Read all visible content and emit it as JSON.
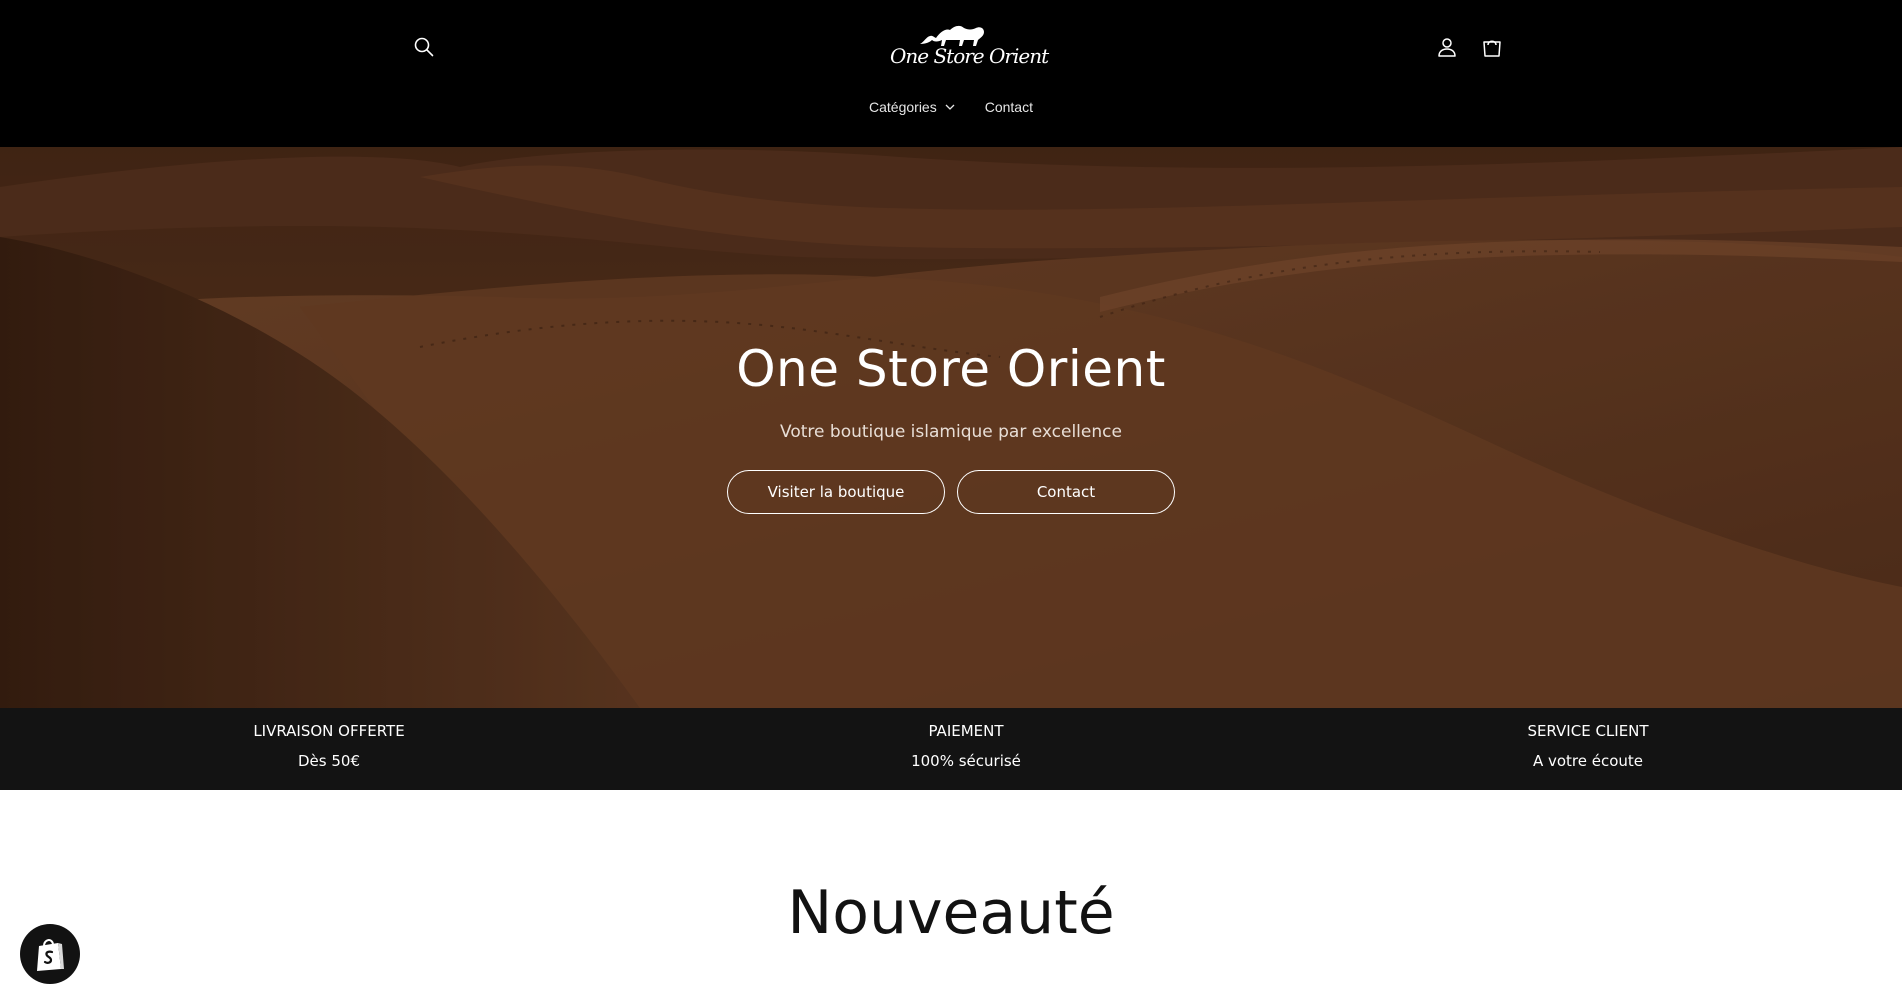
{
  "header": {
    "logo_text": "One Store Orient",
    "icons": {
      "search": "search-icon",
      "account": "user-icon",
      "cart": "cart-icon"
    },
    "nav": [
      {
        "label": "Catégories",
        "has_dropdown": true
      },
      {
        "label": "Contact",
        "has_dropdown": false
      }
    ]
  },
  "hero": {
    "title": "One Store Orient",
    "subtitle": "Votre boutique islamique par excellence",
    "buttons": [
      {
        "label": "Visiter la boutique"
      },
      {
        "label": "Contact"
      }
    ]
  },
  "features": [
    {
      "title": "LIVRAISON OFFERTE",
      "subtitle": "Dès 50€"
    },
    {
      "title": "PAIEMENT",
      "subtitle": "100% sécurisé"
    },
    {
      "title": "SERVICE CLIENT",
      "subtitle": "A votre écoute"
    }
  ],
  "section": {
    "title": "Nouveauté"
  },
  "badge": {
    "icon": "shopify-bag-icon"
  },
  "colors": {
    "header_bg": "#000000",
    "features_bg": "#131313",
    "hero_sand": "#6a3e24",
    "text_light": "#ffffff"
  }
}
